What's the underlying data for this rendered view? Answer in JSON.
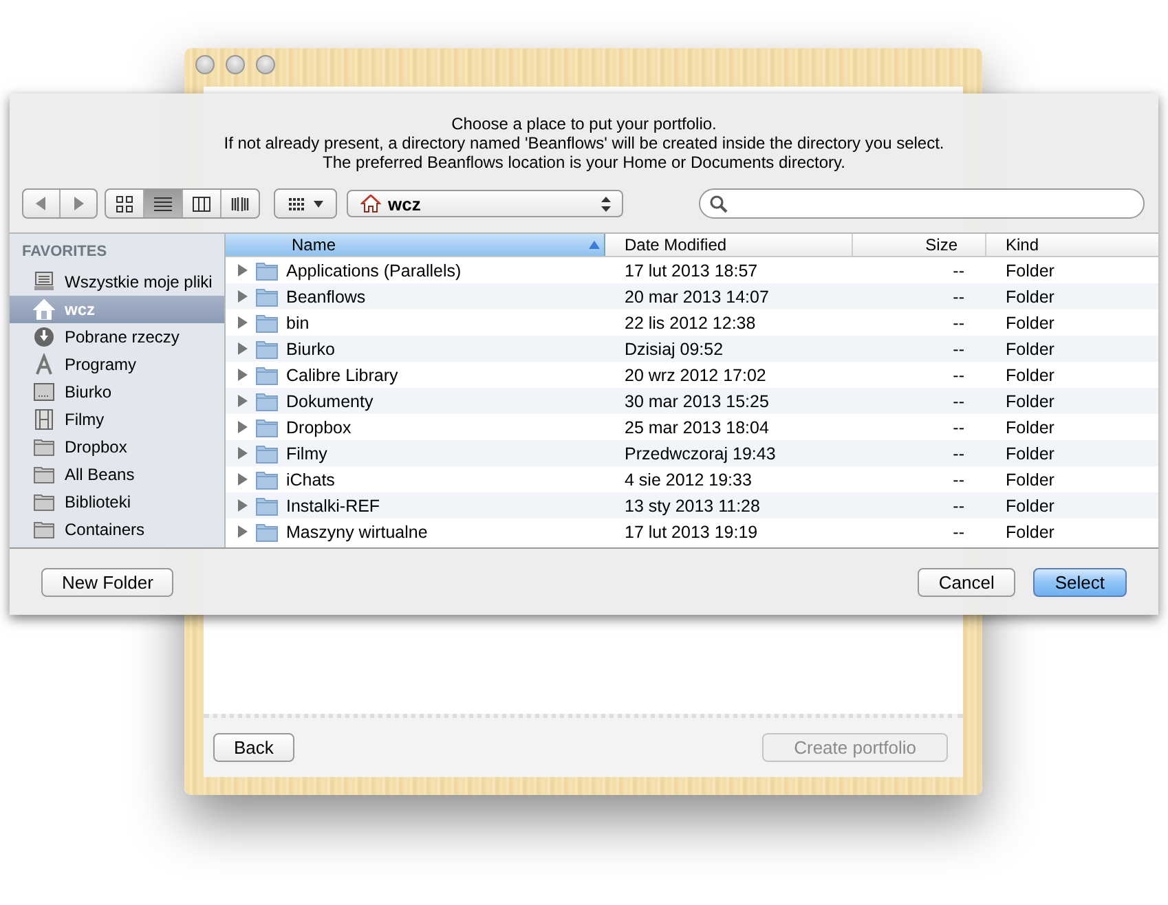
{
  "background_window": {
    "buttons": [
      {
        "label": "Back",
        "disabled": false
      },
      {
        "label": "Create portfolio",
        "disabled": true
      }
    ]
  },
  "sheet": {
    "message": [
      "Choose a place to put your portfolio.",
      "If not already present, a directory named 'Beanflows' will be created inside the directory you select.",
      "The preferred Beanflows location is your Home or Documents directory."
    ],
    "view_modes": [
      {
        "kind": "icons",
        "selected": false
      },
      {
        "kind": "list",
        "selected": true
      },
      {
        "kind": "columns",
        "selected": false
      },
      {
        "kind": "coverflow",
        "selected": false
      }
    ],
    "location": "wcz",
    "sidebar": {
      "heading": "FAVORITES",
      "items": [
        {
          "label": "Wszystkie moje pliki",
          "kind": "files",
          "selected": false
        },
        {
          "label": "wcz",
          "kind": "home",
          "selected": true
        },
        {
          "label": "Pobrane rzeczy",
          "kind": "download",
          "selected": false
        },
        {
          "label": "Programy",
          "kind": "apps",
          "selected": false
        },
        {
          "label": "Biurko",
          "kind": "desktop",
          "selected": false
        },
        {
          "label": "Filmy",
          "kind": "film",
          "selected": false
        },
        {
          "label": "Dropbox",
          "kind": "folder",
          "selected": false
        },
        {
          "label": "All Beans",
          "kind": "folder",
          "selected": false
        },
        {
          "label": "Biblioteki",
          "kind": "folder",
          "selected": false
        },
        {
          "label": "Containers",
          "kind": "folder",
          "selected": false
        }
      ]
    },
    "table": {
      "columns": [
        {
          "label": "Name",
          "selected": true
        },
        {
          "label": "Date Modified",
          "selected": false
        },
        {
          "label": "Size",
          "selected": false
        },
        {
          "label": "Kind",
          "selected": false
        }
      ],
      "rows": [
        [
          "Applications (Parallels)",
          "17 lut 2013 18:57",
          "--",
          "Folder"
        ],
        [
          "Beanflows",
          "20 mar 2013 14:07",
          "--",
          "Folder"
        ],
        [
          "bin",
          "22 lis 2012 12:38",
          "--",
          "Folder"
        ],
        [
          "Biurko",
          "Dzisiaj 09:52",
          "--",
          "Folder"
        ],
        [
          "Calibre Library",
          "20 wrz 2012 17:02",
          "--",
          "Folder"
        ],
        [
          "Dokumenty",
          "30 mar 2013 15:25",
          "--",
          "Folder"
        ],
        [
          "Dropbox",
          "25 mar 2013 18:04",
          "--",
          "Folder"
        ],
        [
          "Filmy",
          "Przedwczoraj 19:43",
          "--",
          "Folder"
        ],
        [
          "iChats",
          "4 sie 2012 19:33",
          "--",
          "Folder"
        ],
        [
          "Instalki-REF",
          "13 sty 2013 11:28",
          "--",
          "Folder"
        ],
        [
          "Maszyny wirtualne",
          "17 lut 2013 19:19",
          "--",
          "Folder"
        ]
      ]
    },
    "buttons": [
      {
        "label": "New Folder",
        "default": false
      },
      {
        "label": "Cancel",
        "default": false
      },
      {
        "label": "Select",
        "default": true
      }
    ]
  }
}
